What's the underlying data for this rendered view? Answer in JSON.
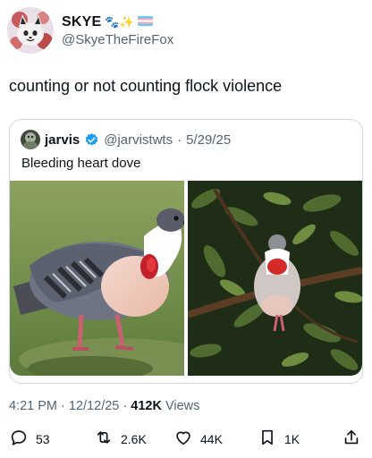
{
  "author": {
    "display_name": "SKYE",
    "emoji_badges": "🐾✨",
    "handle": "@SkyeTheFireFox"
  },
  "tweet": {
    "text": "counting or not counting flock violence"
  },
  "quoted": {
    "display_name": "jarvis",
    "handle": "@jarvistwts",
    "separator": "·",
    "date": "5/29/25",
    "text": "Bleeding heart dove"
  },
  "meta": {
    "time": "4:21 PM",
    "sep1": "·",
    "date": "12/12/25",
    "sep2": "·",
    "views_count": "412K",
    "views_label": "Views"
  },
  "actions": {
    "replies": "53",
    "reposts": "2.6K",
    "likes": "44K",
    "bookmarks": "1K"
  },
  "colors": {
    "verified": "#1d9bf0",
    "muted": "#536471",
    "border": "#cfd9de"
  }
}
